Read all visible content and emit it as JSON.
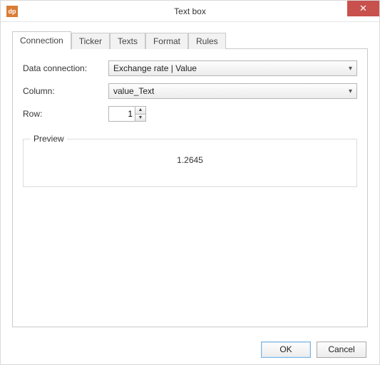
{
  "window": {
    "title": "Text box",
    "icon_text": "dp"
  },
  "tabs": [
    {
      "label": "Connection",
      "active": true
    },
    {
      "label": "Ticker",
      "active": false
    },
    {
      "label": "Texts",
      "active": false
    },
    {
      "label": "Format",
      "active": false
    },
    {
      "label": "Rules",
      "active": false
    }
  ],
  "form": {
    "data_connection_label": "Data connection:",
    "data_connection_value": "Exchange rate | Value",
    "column_label": "Column:",
    "column_value": "value_Text",
    "row_label": "Row:",
    "row_value": "1"
  },
  "preview": {
    "legend": "Preview",
    "value": "1.2645"
  },
  "buttons": {
    "ok": "OK",
    "cancel": "Cancel"
  }
}
